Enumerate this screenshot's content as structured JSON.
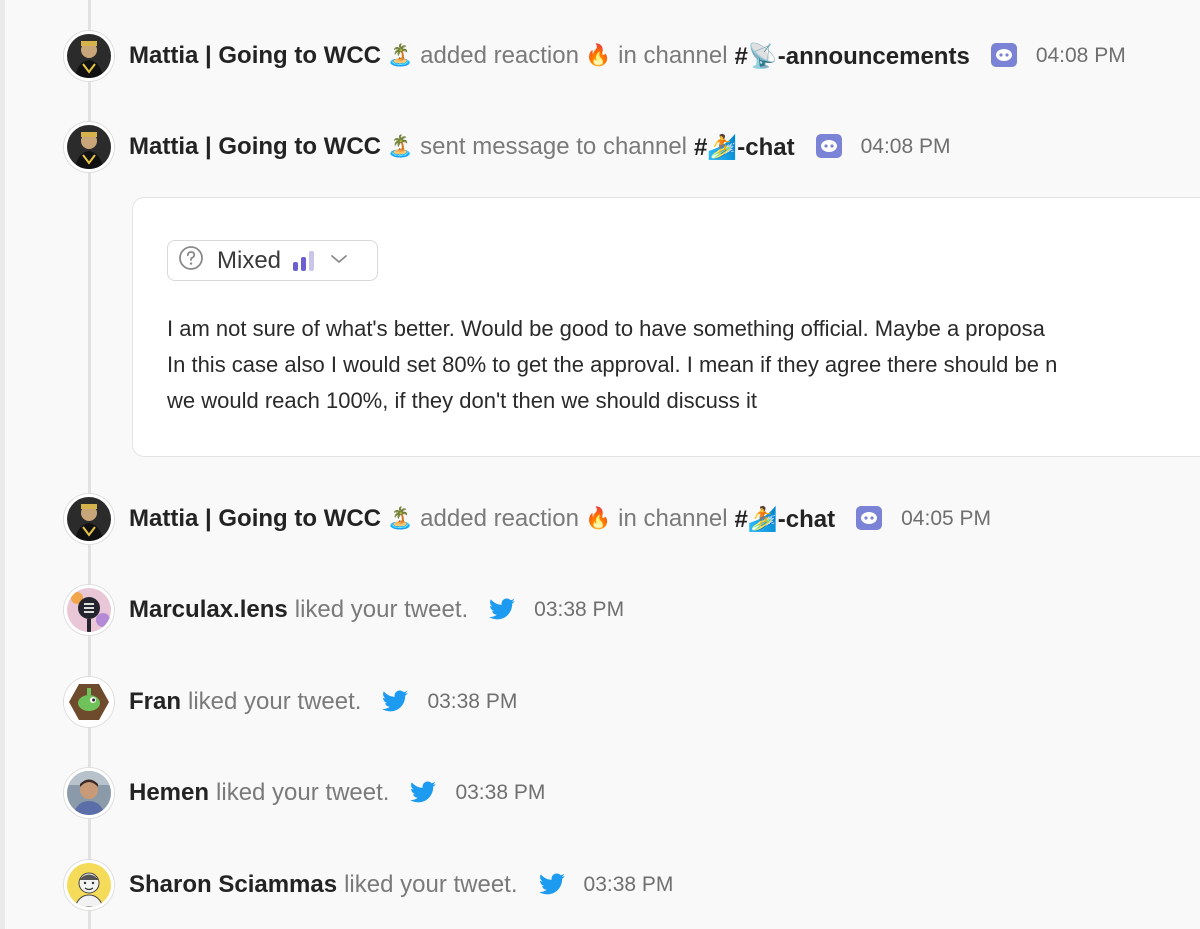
{
  "events": [
    {
      "actor": "Mattia | Going to WCC",
      "actor_emoji": "🏝️",
      "verb": "added reaction",
      "reaction": "🔥",
      "verb2": "in channel",
      "channel": "#📡-announcements",
      "source": "discord",
      "time": "04:08 PM"
    },
    {
      "actor": "Mattia | Going to WCC",
      "actor_emoji": "🏝️",
      "verb": "sent message to channel",
      "channel": "#🏄-chat",
      "source": "discord",
      "time": "04:08 PM"
    },
    {
      "actor": "Mattia | Going to WCC",
      "actor_emoji": "🏝️",
      "verb": "added reaction",
      "reaction": "🔥",
      "verb2": "in channel",
      "channel": "#🏄-chat",
      "source": "discord",
      "time": "04:05 PM"
    },
    {
      "actor": "Marculax.lens",
      "verb": "liked your tweet.",
      "source": "twitter",
      "time": "03:38 PM"
    },
    {
      "actor": "Fran",
      "verb": "liked your tweet.",
      "source": "twitter",
      "time": "03:38 PM"
    },
    {
      "actor": "Hemen",
      "verb": "liked your tweet.",
      "source": "twitter",
      "time": "03:38 PM"
    },
    {
      "actor": "Sharon Sciammas",
      "verb": "liked your tweet.",
      "source": "twitter",
      "time": "03:38 PM"
    }
  ],
  "message_card": {
    "sentiment": "Mixed",
    "lines": [
      "I am not sure of what's better. Would be good to have something official. Maybe a proposa",
      "In this case also I would set 80% to get the approval. I mean if they agree there should be n",
      "we would reach 100%, if they don't then we should discuss it"
    ]
  },
  "colors": {
    "discord": "#7b83d6",
    "twitter": "#1d9bf0",
    "sentiment_bars": "#6b5fd1",
    "timeline": "#e2e2e2"
  }
}
